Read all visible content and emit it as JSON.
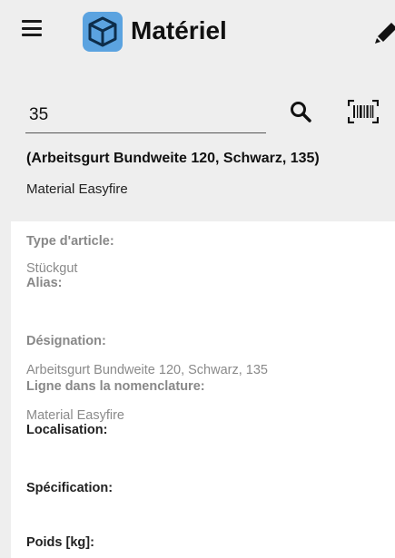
{
  "header": {
    "title": "Matériel",
    "menu_icon": "hamburger-menu-icon",
    "logo_icon": "cube-icon",
    "edit_icon": "pencil-icon",
    "accent_color": "#5ba3e0"
  },
  "search": {
    "value": "35",
    "search_icon": "search-icon",
    "scan_icon": "barcode-scan-icon"
  },
  "article": {
    "summary": "(Arbeitsgurt Bundweite 120, Schwarz, 135)",
    "group": "Material Easyfire"
  },
  "details": {
    "type_label": "Type d'article:",
    "type_value": "Stückgut",
    "alias_label": "Alias:",
    "designation_label": "Désignation:",
    "designation_value": "Arbeitsgurt Bundweite 120, Schwarz, 135",
    "bom_label": "Ligne dans la nomenclature:",
    "bom_value": "Material Easyfire",
    "location_label": "Localisation:",
    "spec_label": "Spécification:",
    "weight_label": "Poids [kg]:"
  }
}
